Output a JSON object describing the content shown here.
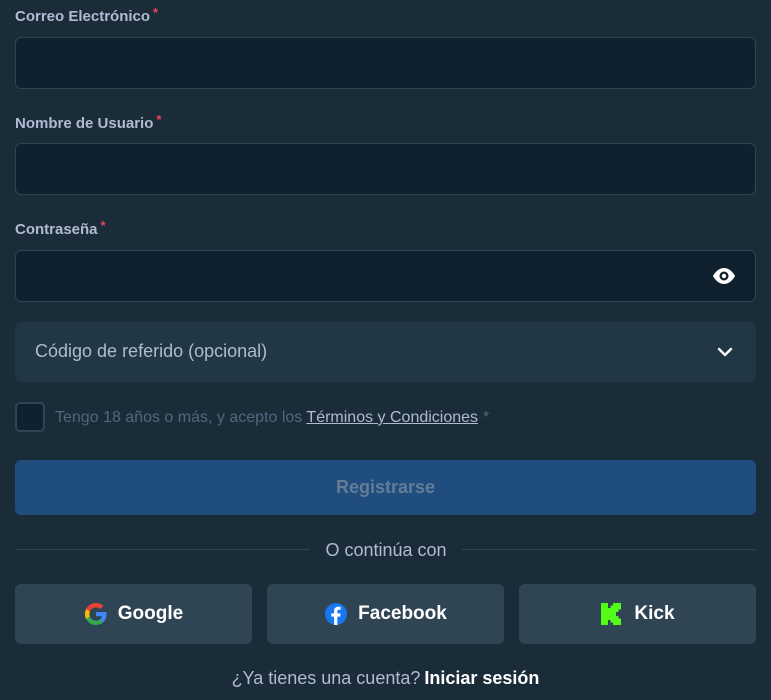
{
  "fields": {
    "email": {
      "label": "Correo Electrónico",
      "required_mark": "*",
      "value": "",
      "placeholder": ""
    },
    "username": {
      "label": "Nombre de Usuario",
      "required_mark": "*",
      "value": "",
      "placeholder": ""
    },
    "password": {
      "label": "Contraseña",
      "required_mark": "*",
      "value": "",
      "placeholder": ""
    }
  },
  "referral": {
    "label": "Código de referido (opcional)"
  },
  "terms": {
    "text": "Tengo 18 años o más, y acepto los",
    "link": "Términos y Condiciones",
    "required_mark": "*",
    "checked": false
  },
  "register_button": {
    "label": "Registrarse"
  },
  "divider": {
    "text": "O continúa con"
  },
  "social": {
    "google": {
      "label": "Google",
      "icon": "google-icon"
    },
    "facebook": {
      "label": "Facebook",
      "icon": "facebook-icon"
    },
    "kick": {
      "label": "Kick",
      "icon": "kick-icon"
    }
  },
  "signin": {
    "question": "¿Ya tienes una cuenta?",
    "link": "Iniciar sesión"
  },
  "colors": {
    "background": "#1a2c38",
    "input_bg": "#0f212e",
    "button_primary": "#1f4d7e",
    "social_bg": "#2f4553",
    "required": "#ed4163",
    "kick_green": "#53fc18",
    "facebook_blue": "#1877f2"
  }
}
